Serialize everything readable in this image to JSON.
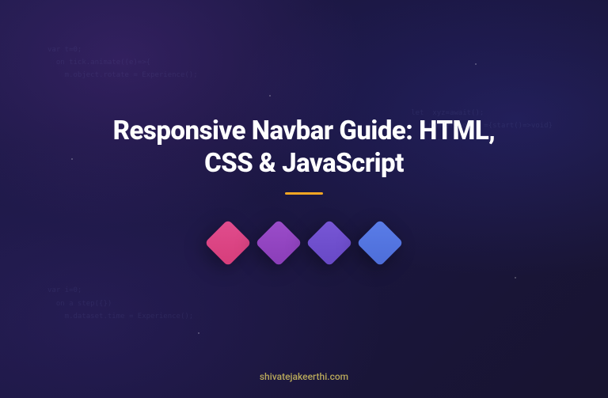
{
  "hero": {
    "title": "Responsive Navbar Guide: HTML, CSS & JavaScript"
  },
  "footer": {
    "domain": "shivatejakeerthi.com"
  },
  "decorations": {
    "code_tl": "var t=0;\n  on tick.animate((e)=>{\n    m.object.rotate = Experience();",
    "code_tr": "let  xyz=await();\n    renderLoop   ={start()=>void}\n    ...",
    "code_bl": "var i=0;\n  on a step({})\n    m.dataset.time = Experience();"
  },
  "squares": {
    "colors": [
      "#e14d8e",
      "#9b4dca",
      "#7857d6",
      "#5a7de8"
    ]
  }
}
